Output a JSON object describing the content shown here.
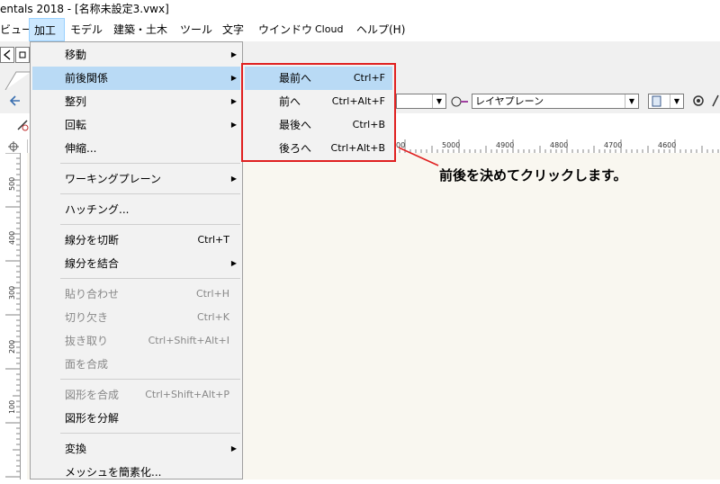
{
  "window": {
    "title": "entals 2018 - [名称未設定3.vwx]"
  },
  "menubar": {
    "items": [
      {
        "label": "ビュー"
      },
      {
        "label": "加工",
        "active": true
      },
      {
        "label": "モデル"
      },
      {
        "label": "建築・土木"
      },
      {
        "label": "ツール"
      },
      {
        "label": "文字"
      },
      {
        "label": "ウインドウ"
      },
      {
        "label": "Cloud"
      },
      {
        "label": "ヘルプ(H)"
      }
    ]
  },
  "toolbar": {
    "layer_dropdown": "レイヤプレーン"
  },
  "ruler": {
    "top_labels": [
      "00",
      "5000",
      "4900",
      "4800",
      "4700",
      "4600"
    ],
    "left_labels": [
      "500",
      "400",
      "300",
      "200",
      "100"
    ]
  },
  "menu": {
    "items": [
      {
        "label": "移動",
        "shortcut": "",
        "submenu": true
      },
      {
        "label": "前後関係",
        "shortcut": "",
        "submenu": true,
        "highlighted": true
      },
      {
        "label": "整列",
        "shortcut": "",
        "submenu": true
      },
      {
        "label": "回転",
        "shortcut": "",
        "submenu": true
      },
      {
        "label": "伸縮...",
        "shortcut": ""
      },
      {
        "label": "ワーキングプレーン",
        "shortcut": "",
        "submenu": true
      },
      {
        "label": "ハッチング...",
        "shortcut": ""
      },
      {
        "label": "線分を切断",
        "shortcut": "Ctrl+T"
      },
      {
        "label": "線分を結合",
        "shortcut": "",
        "submenu": true
      },
      {
        "label": "貼り合わせ",
        "shortcut": "Ctrl+H",
        "disabled": true
      },
      {
        "label": "切り欠き",
        "shortcut": "Ctrl+K",
        "disabled": true
      },
      {
        "label": "抜き取り",
        "shortcut": "Ctrl+Shift+Alt+I",
        "disabled": true
      },
      {
        "label": "面を合成",
        "shortcut": "",
        "disabled": true
      },
      {
        "label": "図形を合成",
        "shortcut": "Ctrl+Shift+Alt+P",
        "disabled": true
      },
      {
        "label": "図形を分解",
        "shortcut": ""
      },
      {
        "label": "変換",
        "shortcut": "",
        "submenu": true
      },
      {
        "label": "メッシュを簡素化...",
        "shortcut": ""
      }
    ]
  },
  "submenu": {
    "items": [
      {
        "label": "最前へ",
        "shortcut": "Ctrl+F",
        "highlighted": true
      },
      {
        "label": "前へ",
        "shortcut": "Ctrl+Alt+F"
      },
      {
        "label": "最後へ",
        "shortcut": "Ctrl+B"
      },
      {
        "label": "後ろへ",
        "shortcut": "Ctrl+Alt+B"
      }
    ]
  },
  "annotation": {
    "text": "前後を決めてクリックします。"
  },
  "colors": {
    "highlight": "#b9daf5",
    "callout_border": "#e02020",
    "canvas": "#f9f7f0"
  }
}
